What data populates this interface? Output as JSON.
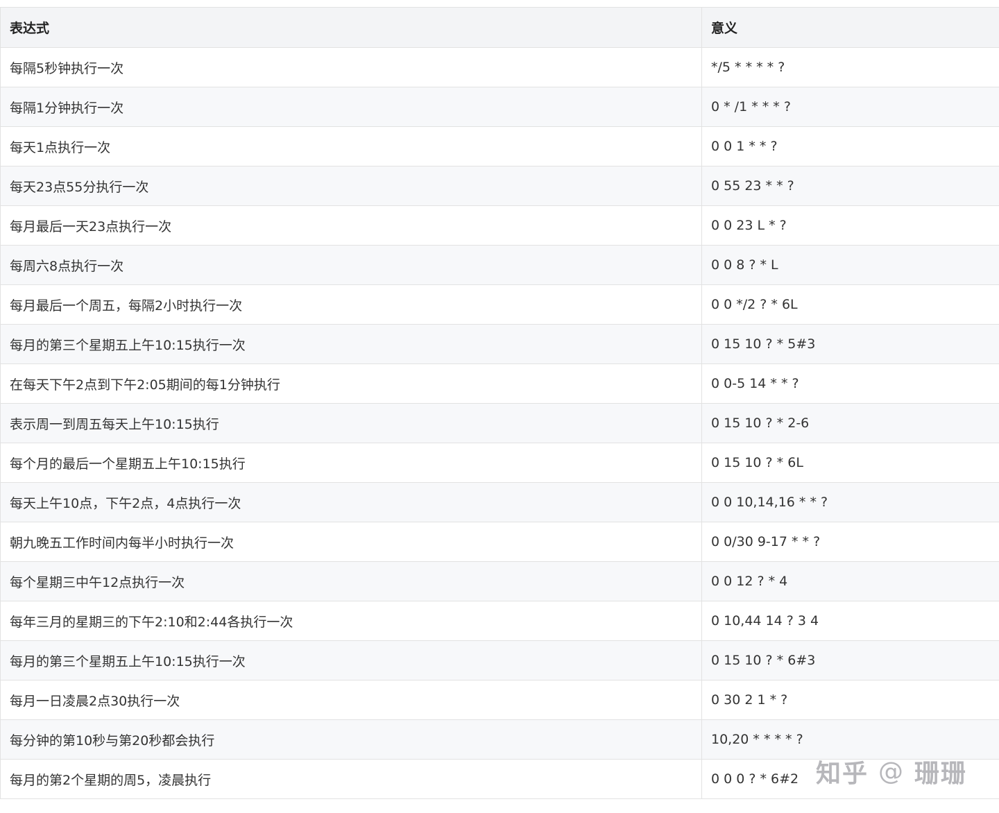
{
  "table": {
    "headers": [
      "表达式",
      "意义"
    ],
    "rows": [
      [
        "每隔5秒钟执行一次",
        "*/5 * * * * ?"
      ],
      [
        "每隔1分钟执行一次",
        "0 * /1 * * * ?"
      ],
      [
        "每天1点执行一次",
        "0 0 1 * * ?"
      ],
      [
        "每天23点55分执行一次",
        "0 55 23 * * ?"
      ],
      [
        "每月最后一天23点执行一次",
        "0 0 23 L * ?"
      ],
      [
        "每周六8点执行一次",
        "0 0 8 ? * L"
      ],
      [
        "每月最后一个周五，每隔2小时执行一次",
        "0 0 */2 ? * 6L"
      ],
      [
        "每月的第三个星期五上午10:15执行一次",
        "0 15 10 ? * 5#3"
      ],
      [
        "在每天下午2点到下午2:05期间的每1分钟执行",
        "0 0-5 14 * * ?"
      ],
      [
        "表示周一到周五每天上午10:15执行",
        "0 15 10 ? * 2-6"
      ],
      [
        "每个月的最后一个星期五上午10:15执行",
        "0 15 10 ? * 6L"
      ],
      [
        "每天上午10点，下午2点，4点执行一次",
        "0 0 10,14,16 * * ?"
      ],
      [
        "朝九晚五工作时间内每半小时执行一次",
        "0 0/30 9-17 * * ?"
      ],
      [
        "每个星期三中午12点执行一次",
        "0 0 12 ? * 4"
      ],
      [
        "每年三月的星期三的下午2:10和2:44各执行一次",
        "0 10,44 14 ? 3 4"
      ],
      [
        "每月的第三个星期五上午10:15执行一次",
        "0 15 10 ? * 6#3"
      ],
      [
        "每月一日凌晨2点30执行一次",
        "0 30 2 1 * ?"
      ],
      [
        "每分钟的第10秒与第20秒都会执行",
        "10,20 * * * * ?"
      ],
      [
        "每月的第2个星期的周5，凌晨执行",
        "0 0 0 ? * 6#2"
      ]
    ]
  },
  "watermark": {
    "brand": "知乎",
    "at": "@",
    "author": "珊珊"
  }
}
